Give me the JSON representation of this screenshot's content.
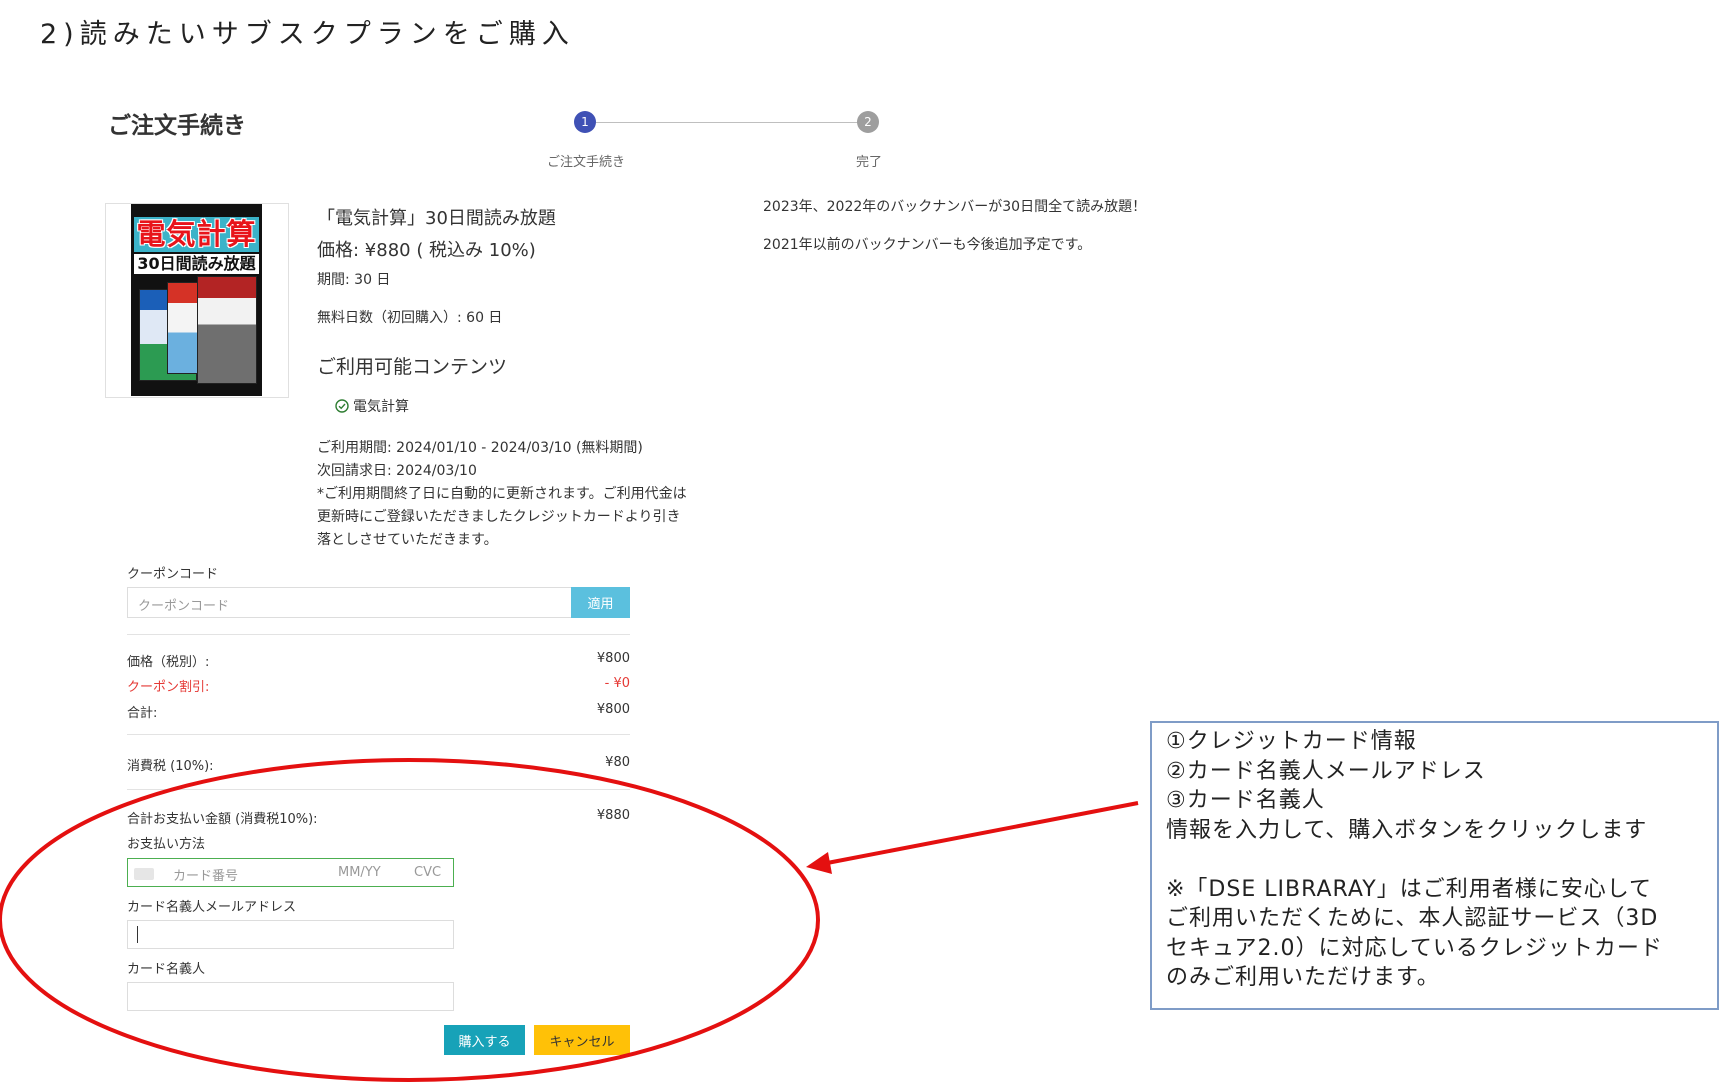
{
  "page": {
    "heading": "2)読みたいサブスクプランをご購入"
  },
  "order": {
    "title": "ご注文手続き"
  },
  "stepper": {
    "active_color": "#3f51b5",
    "inactive_color": "#9e9e9e",
    "steps": [
      {
        "number": "1",
        "label": "ご注文手続き"
      },
      {
        "number": "2",
        "label": "完了"
      }
    ]
  },
  "product": {
    "cover_title": "電気計算",
    "cover_subtitle": "30日間読み放題",
    "name": "「電気計算」30日間読み放題",
    "price": "価格: ¥880 ( 税込み 10%)",
    "period": "期間: 30 日",
    "free_days": "無料日数（初回購入）: 60 日",
    "contents_heading": "ご利用可能コンテンツ",
    "content_item": "電気計算",
    "usage_period": "ご利用期間: 2024/01/10 - 2024/03/10 (無料期間)",
    "next_billing": "次回請求日: 2024/03/10",
    "note_lines": [
      "*ご利用期間終了日に自動的に更新されます。ご利用代金は",
      "更新時にご登録いただきましたクレジットカードより引き",
      "落としさせていただきます。"
    ]
  },
  "description": {
    "line1": "2023年、2022年のバックナンバーが30日間全て読み放題！",
    "line2": "2021年以前のバックナンバーも今後追加予定です。"
  },
  "coupon": {
    "label": "クーポンコード",
    "placeholder": "クーポンコード",
    "apply_button": "適用"
  },
  "summary": {
    "subtotal_label": "価格（税別）:",
    "subtotal_value": "¥800",
    "discount_label": "クーポン割引:",
    "discount_value": "- ¥0",
    "total_label": "合計:",
    "total_value": "¥800",
    "tax_label": "消費税 (10%):",
    "tax_value": "¥80",
    "grand_label": "合計お支払い金額 (消費税10%):",
    "grand_value": "¥880"
  },
  "payment": {
    "method_label": "お支払い方法",
    "card_placeholder": "カード番号",
    "expiry_placeholder": "MM/YY",
    "cvc_placeholder": "CVC",
    "email_label": "カード名義人メールアドレス",
    "holder_label": "カード名義人",
    "purchase_button": "購入する",
    "cancel_button": "キャンセル"
  },
  "colors": {
    "apply_button": "#5bc0de",
    "purchase_button": "#17a2b8",
    "cancel_button": "#ffc107",
    "discount_text": "#e53935",
    "card_field_border": "#4caf50",
    "annotation": "#e41010",
    "callout_border": "#7f9cc7"
  },
  "callout": {
    "lines": [
      "①クレジットカード情報",
      "②カード名義人メールアドレス",
      "③カード名義人",
      "情報を入力して、購入ボタンをクリックします",
      "",
      "※「DSE LIBRARAY」はご利用者様に安心して",
      "ご利用いただくために、本人認証サービス（3D",
      "セキュア2.0）に対応しているクレジットカード",
      "のみご利用いただけます。"
    ]
  }
}
